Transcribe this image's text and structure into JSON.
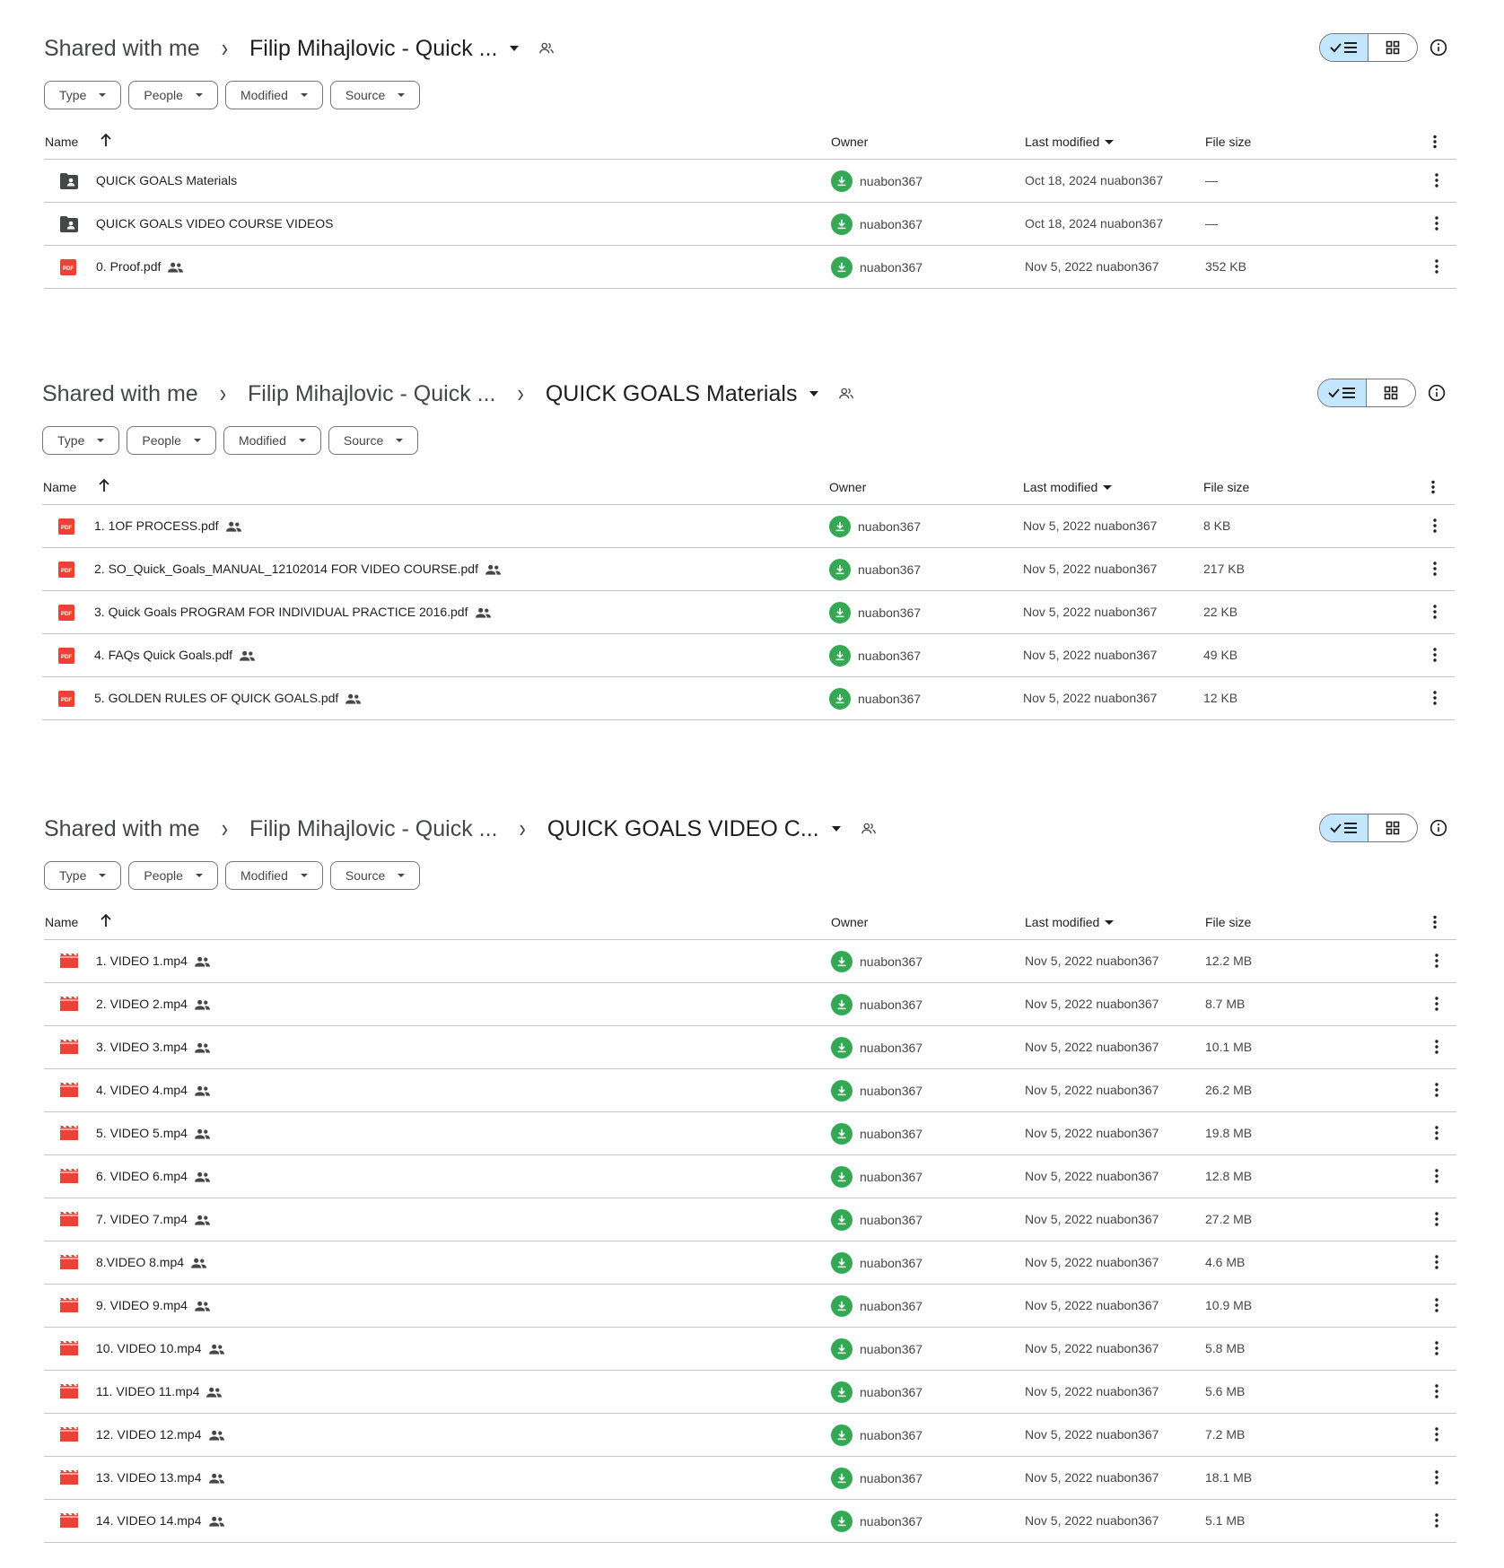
{
  "panels": [
    {
      "breadcrumb": [
        "Shared with me",
        "Filip Mihajlovic - Quick ..."
      ],
      "filters": [
        "Type",
        "People",
        "Modified",
        "Source"
      ],
      "columns": {
        "name": "Name",
        "owner": "Owner",
        "modified": "Last modified",
        "size": "File size"
      },
      "rows": [
        {
          "type": "shared-folder",
          "name": "QUICK GOALS Materials",
          "shared": false,
          "owner": "nuabon367",
          "modified": "Oct 18, 2024 nuabon367",
          "size": "—"
        },
        {
          "type": "shared-folder",
          "name": "QUICK GOALS VIDEO COURSE VIDEOS",
          "shared": false,
          "owner": "nuabon367",
          "modified": "Oct 18, 2024 nuabon367",
          "size": "—"
        },
        {
          "type": "pdf",
          "name": "0. Proof.pdf",
          "shared": true,
          "owner": "nuabon367",
          "modified": "Nov 5, 2022 nuabon367",
          "size": "352 KB"
        }
      ]
    },
    {
      "breadcrumb": [
        "Shared with me",
        "Filip Mihajlovic - Quick ...",
        "QUICK GOALS Materials"
      ],
      "filters": [
        "Type",
        "People",
        "Modified",
        "Source"
      ],
      "columns": {
        "name": "Name",
        "owner": "Owner",
        "modified": "Last modified",
        "size": "File size"
      },
      "rows": [
        {
          "type": "pdf",
          "name": "1. 1OF PROCESS.pdf",
          "shared": true,
          "owner": "nuabon367",
          "modified": "Nov 5, 2022 nuabon367",
          "size": "8 KB"
        },
        {
          "type": "pdf",
          "name": "2. SO_Quick_Goals_MANUAL_12102014 FOR VIDEO COURSE.pdf",
          "shared": true,
          "owner": "nuabon367",
          "modified": "Nov 5, 2022 nuabon367",
          "size": "217 KB"
        },
        {
          "type": "pdf",
          "name": "3. Quick Goals PROGRAM FOR INDIVIDUAL PRACTICE 2016.pdf",
          "shared": true,
          "owner": "nuabon367",
          "modified": "Nov 5, 2022 nuabon367",
          "size": "22 KB"
        },
        {
          "type": "pdf",
          "name": "4. FAQs Quick Goals.pdf",
          "shared": true,
          "owner": "nuabon367",
          "modified": "Nov 5, 2022 nuabon367",
          "size": "49 KB"
        },
        {
          "type": "pdf",
          "name": "5. GOLDEN RULES OF QUICK GOALS.pdf",
          "shared": true,
          "owner": "nuabon367",
          "modified": "Nov 5, 2022 nuabon367",
          "size": "12 KB"
        }
      ]
    },
    {
      "breadcrumb": [
        "Shared with me",
        "Filip Mihajlovic - Quick ...",
        "QUICK GOALS VIDEO C..."
      ],
      "filters": [
        "Type",
        "People",
        "Modified",
        "Source"
      ],
      "columns": {
        "name": "Name",
        "owner": "Owner",
        "modified": "Last modified",
        "size": "File size"
      },
      "rows": [
        {
          "type": "video",
          "name": "1. VIDEO 1.mp4",
          "shared": true,
          "owner": "nuabon367",
          "modified": "Nov 5, 2022 nuabon367",
          "size": "12.2 MB"
        },
        {
          "type": "video",
          "name": "2. VIDEO 2.mp4",
          "shared": true,
          "owner": "nuabon367",
          "modified": "Nov 5, 2022 nuabon367",
          "size": "8.7 MB"
        },
        {
          "type": "video",
          "name": "3. VIDEO 3.mp4",
          "shared": true,
          "owner": "nuabon367",
          "modified": "Nov 5, 2022 nuabon367",
          "size": "10.1 MB"
        },
        {
          "type": "video",
          "name": "4. VIDEO 4.mp4",
          "shared": true,
          "owner": "nuabon367",
          "modified": "Nov 5, 2022 nuabon367",
          "size": "26.2 MB"
        },
        {
          "type": "video",
          "name": "5. VIDEO 5.mp4",
          "shared": true,
          "owner": "nuabon367",
          "modified": "Nov 5, 2022 nuabon367",
          "size": "19.8 MB"
        },
        {
          "type": "video",
          "name": "6. VIDEO 6.mp4",
          "shared": true,
          "owner": "nuabon367",
          "modified": "Nov 5, 2022 nuabon367",
          "size": "12.8 MB"
        },
        {
          "type": "video",
          "name": "7. VIDEO 7.mp4",
          "shared": true,
          "owner": "nuabon367",
          "modified": "Nov 5, 2022 nuabon367",
          "size": "27.2 MB"
        },
        {
          "type": "video",
          "name": "8.VIDEO 8.mp4",
          "shared": true,
          "owner": "nuabon367",
          "modified": "Nov 5, 2022 nuabon367",
          "size": "4.6 MB"
        },
        {
          "type": "video",
          "name": "9. VIDEO 9.mp4",
          "shared": true,
          "owner": "nuabon367",
          "modified": "Nov 5, 2022 nuabon367",
          "size": "10.9 MB"
        },
        {
          "type": "video",
          "name": "10. VIDEO 10.mp4",
          "shared": true,
          "owner": "nuabon367",
          "modified": "Nov 5, 2022 nuabon367",
          "size": "5.8 MB"
        },
        {
          "type": "video",
          "name": "11. VIDEO 11.mp4",
          "shared": true,
          "owner": "nuabon367",
          "modified": "Nov 5, 2022 nuabon367",
          "size": "5.6 MB"
        },
        {
          "type": "video",
          "name": "12. VIDEO 12.mp4",
          "shared": true,
          "owner": "nuabon367",
          "modified": "Nov 5, 2022 nuabon367",
          "size": "7.2 MB"
        },
        {
          "type": "video",
          "name": "13. VIDEO 13.mp4",
          "shared": true,
          "owner": "nuabon367",
          "modified": "Nov 5, 2022 nuabon367",
          "size": "18.1 MB"
        },
        {
          "type": "video",
          "name": "14. VIDEO 14.mp4",
          "shared": true,
          "owner": "nuabon367",
          "modified": "Nov 5, 2022 nuabon367",
          "size": "5.1 MB"
        }
      ]
    }
  ],
  "colors": {
    "accent_toggle": "#c2e7ff",
    "owner_avatar": "#34a853",
    "file_red": "#ea4335",
    "divider": "#c4c7c5"
  }
}
